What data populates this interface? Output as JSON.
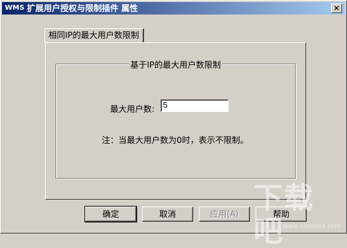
{
  "window": {
    "app_icon": "WMS",
    "title": "扩展用户授权与限制插件 属性",
    "close_glyph": "×"
  },
  "tab": {
    "label": "相同IP的最大用户数限制"
  },
  "group": {
    "title": "基于IP的最大用户数限制",
    "max_users_label": "最大用户数:",
    "max_users_value": "5",
    "note": "注：当最大用户数为0时，表示不限制。"
  },
  "buttons": {
    "ok": "确定",
    "cancel": "取消",
    "apply": "应用(A)",
    "help": "帮助"
  },
  "watermark": {
    "logo": "下载吧",
    "url": "www.xiazaiba.com"
  }
}
